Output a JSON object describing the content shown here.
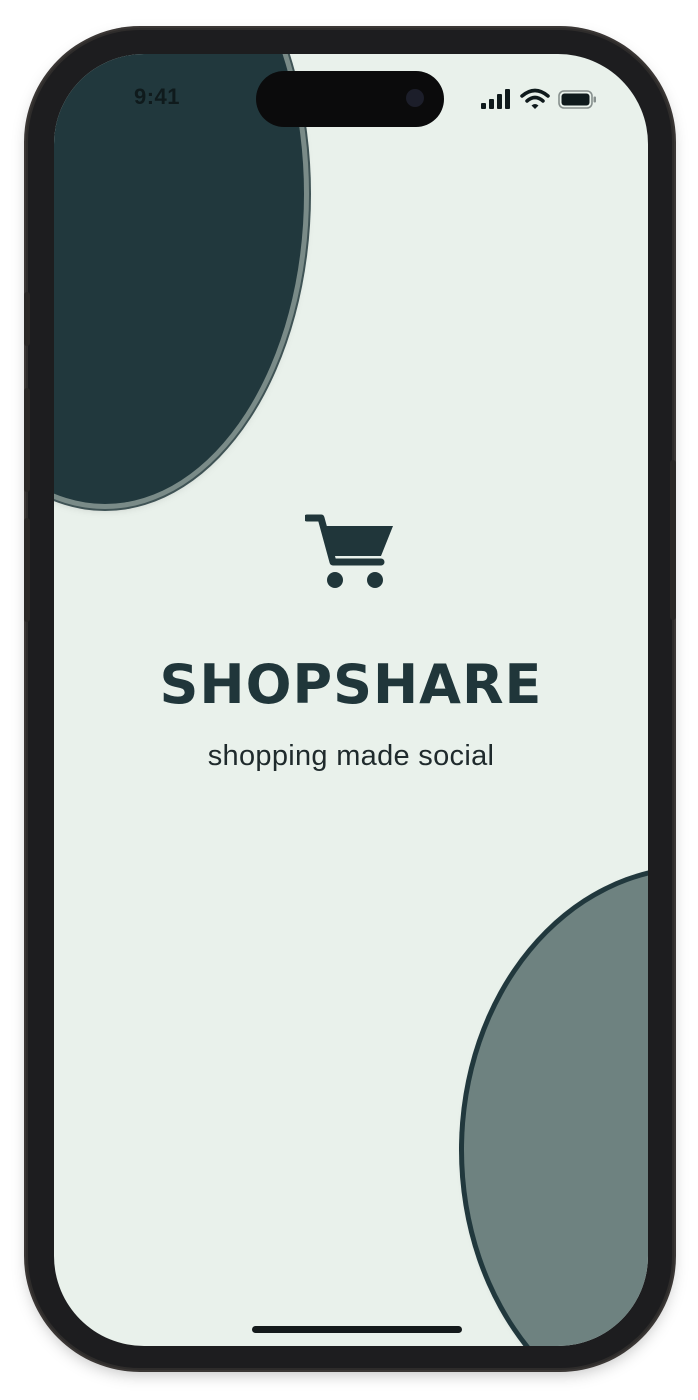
{
  "status_bar": {
    "time": "9:41",
    "icons": [
      "cellular-signal-icon",
      "wifi-icon",
      "battery-icon"
    ]
  },
  "splash": {
    "icon": "shopping-cart-icon",
    "app_name": "SHOPSHARE",
    "tagline": "shopping made social"
  },
  "colors": {
    "background": "#e9f1eb",
    "primary_dark": "#21383d",
    "secondary": "#6e8280",
    "text": "#20363a"
  }
}
